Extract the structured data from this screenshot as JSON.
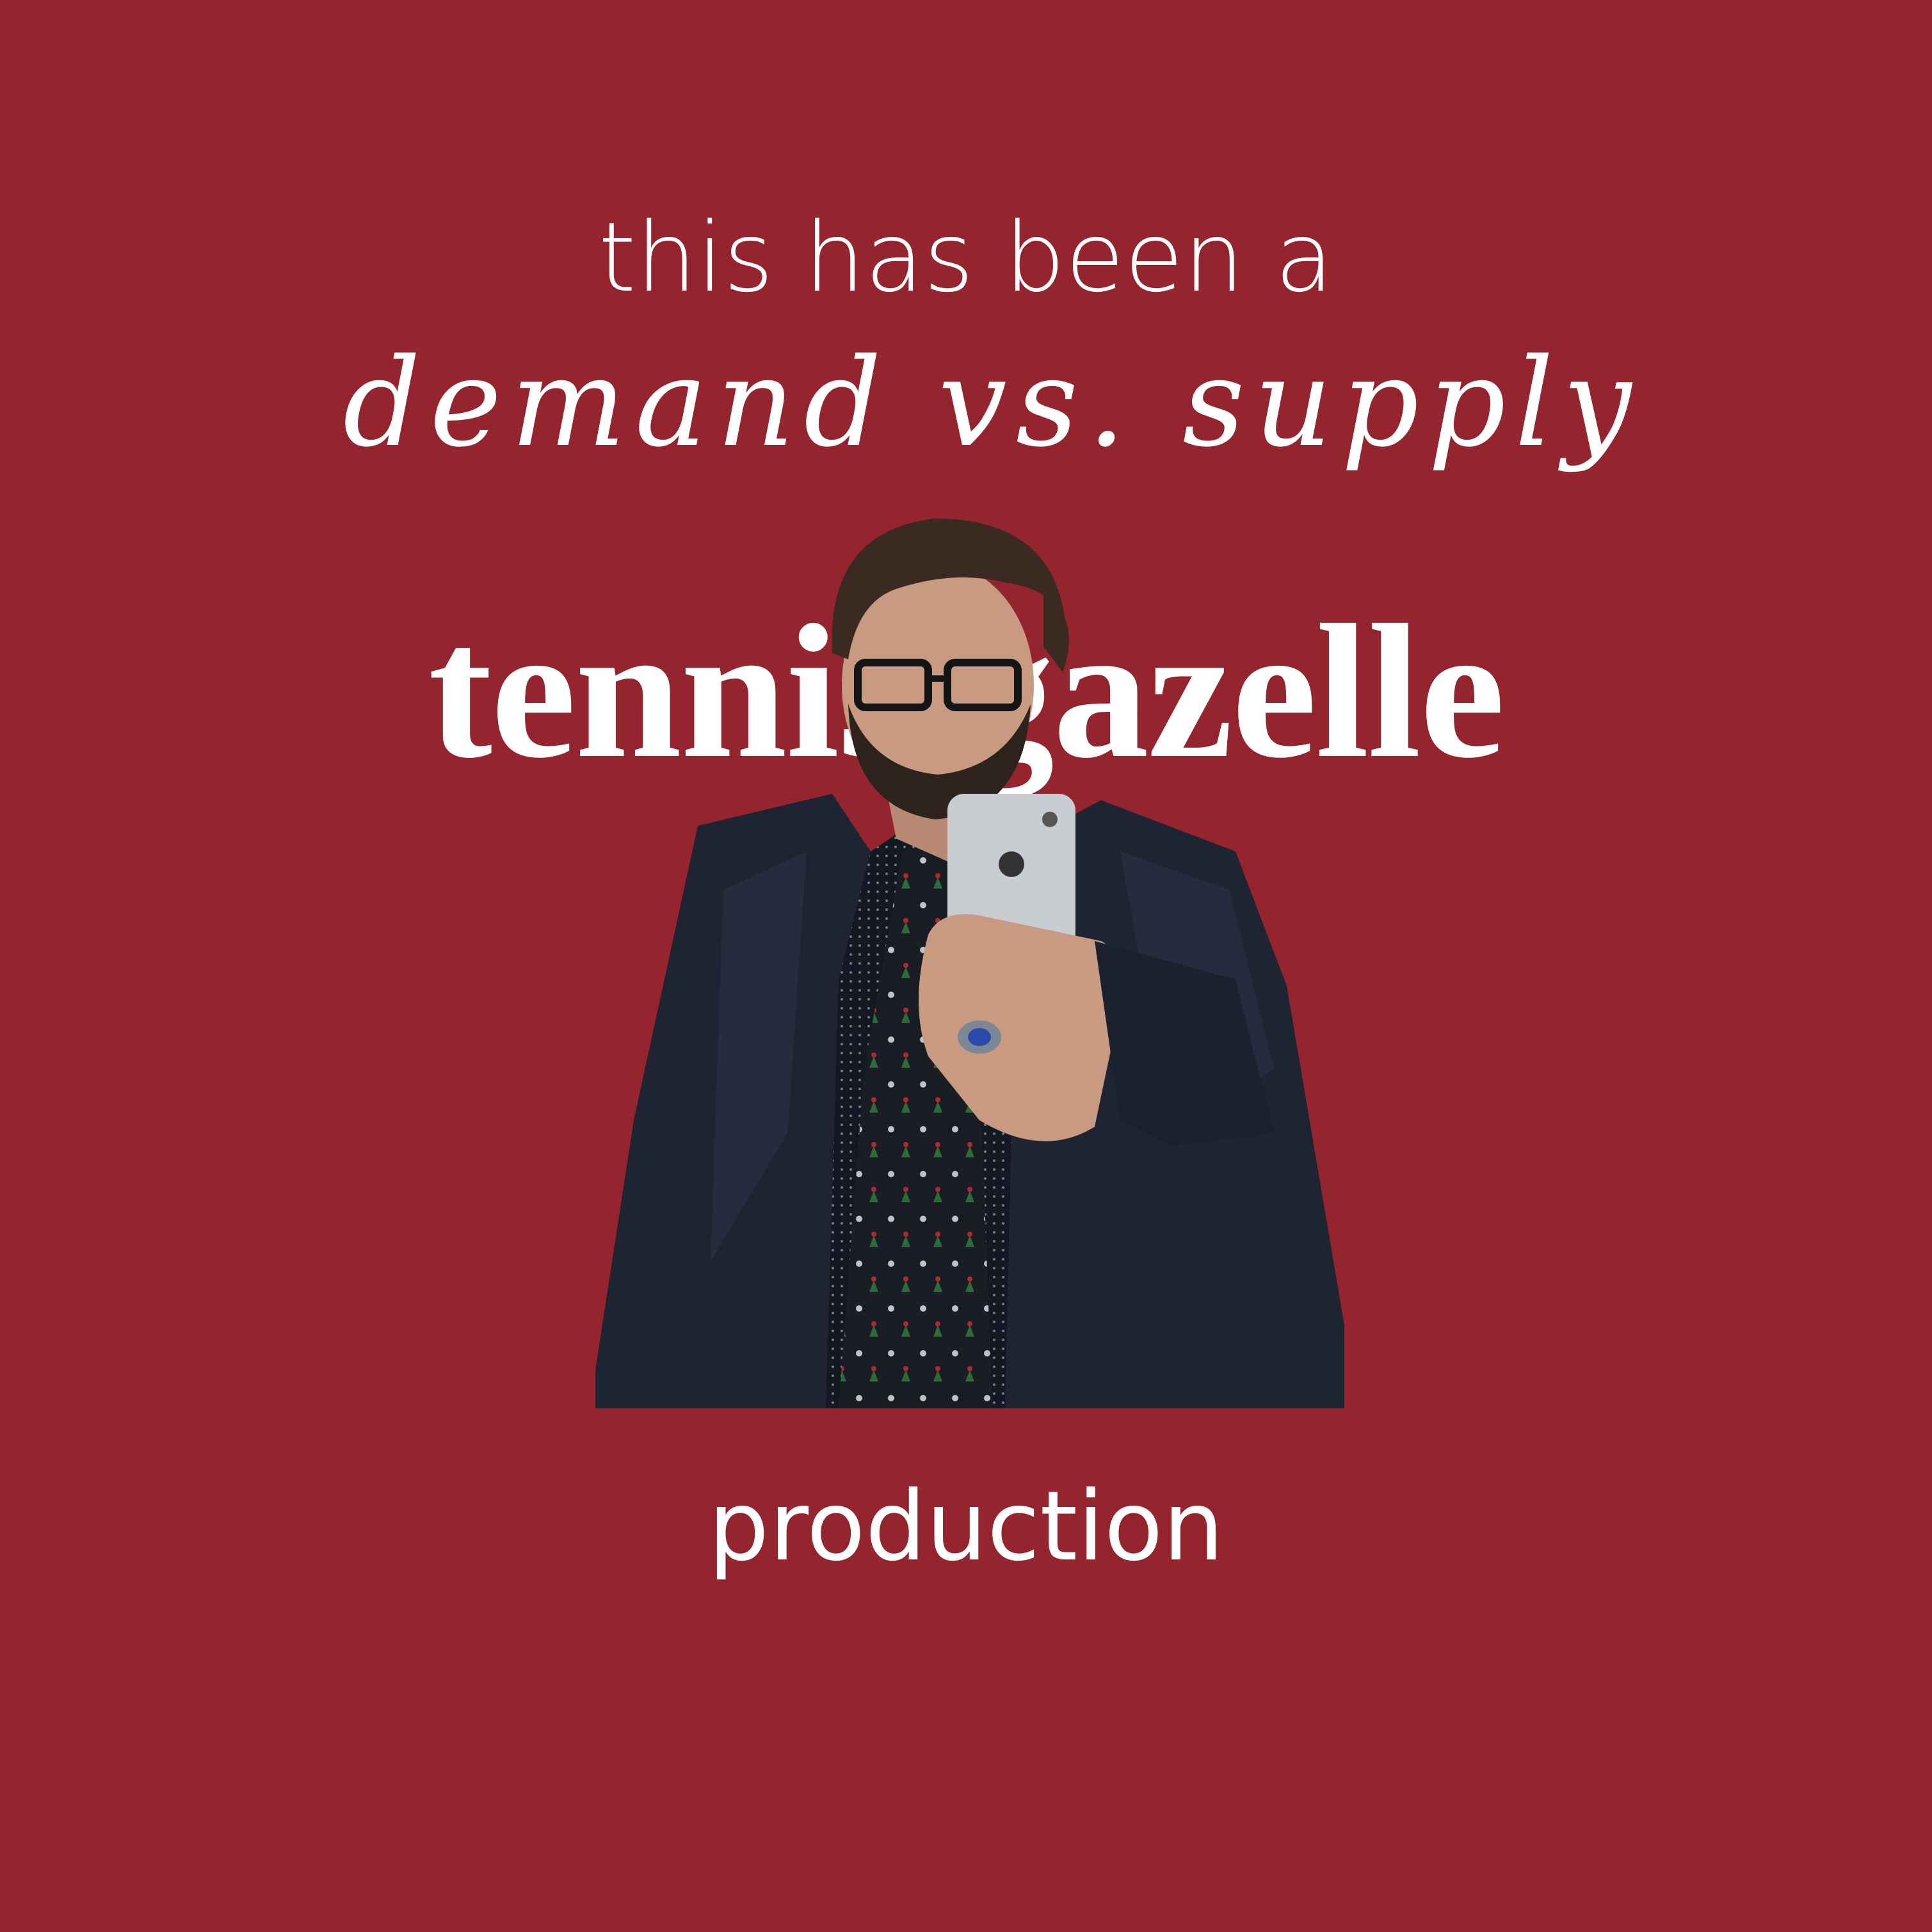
{
  "page": {
    "background_color": "#94252E",
    "text_color": "#FFFFFF"
  },
  "intro_text": "this has been a",
  "production_label": "demand vs. supply",
  "artist_name": "tennis gazelle",
  "closing_text": "production",
  "photo": {
    "description_icon": "person-mirror-selfie",
    "jacket_color": "#1F2433",
    "tie_color": "#1A1D24",
    "phone_color": "#C9CCD1",
    "skin_color": "#C99A82",
    "hair_color": "#3A2A22"
  }
}
